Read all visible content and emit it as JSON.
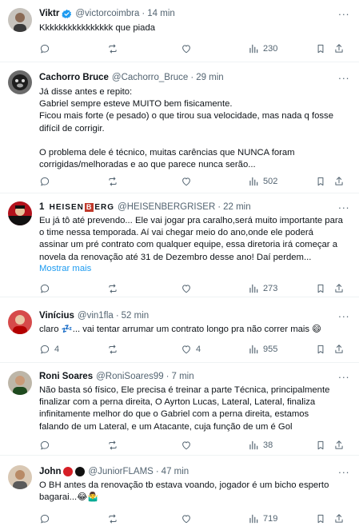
{
  "tweets": [
    {
      "name": "Viktr",
      "verified": true,
      "handle": "@victorcoimbra",
      "time": "14 min",
      "lines": [
        "Kkkkkkkkkkkkkkkk que piada"
      ],
      "replies": "",
      "retweets": "",
      "likes": "",
      "views": "230"
    },
    {
      "name": "Cachorro Bruce",
      "handle": "@Cachorro_Bruce",
      "time": "29 min",
      "lines": [
        "Já disse antes e repito:",
        "Gabriel sempre esteve MUITO bem fisicamente.",
        "Ficou mais forte (e pesado) o que tirou sua velocidade, mas nada q fosse",
        "difícil de corrigir.",
        "",
        "O problema dele é técnico, muitas carências que NUNCA foram",
        "corrigidas/melhoradas e ao que parece nunca serão..."
      ],
      "replies": "",
      "retweets": "",
      "likes": "",
      "views": "502"
    },
    {
      "name_prefix": "1",
      "name_part1": "HEISEN",
      "name_box": "B",
      "name_part2": "ERG",
      "handle": "@HEISENBERGRISER",
      "time": "22 min",
      "lines": [
        "Eu já tô até prevendo... Ele vai jogar pra caralho,será muito importante para",
        "o time nessa temporada. Aí vai chegar meio do ano,onde ele poderá",
        "assinar um pré contrato com qualquer equipe, essa diretoria irá começar a",
        "novela da renovação até 31 de Dezembro desse ano! Daí perdem..."
      ],
      "show_more": "Mostrar mais",
      "replies": "",
      "retweets": "",
      "likes": "",
      "views": "273"
    },
    {
      "name": "Vinícius",
      "handle": "@vin1fla",
      "time": "52 min",
      "lines": [
        "claro 💤... vai tentar arrumar um contrato longo pra não correr mais 😄"
      ],
      "replies": "4",
      "retweets": "",
      "likes": "4",
      "views": "955"
    },
    {
      "name": "Roni Soares",
      "handle": "@RoniSoares99",
      "time": "7 min",
      "lines": [
        "Não basta só físico, Ele precisa é treinar a parte Técnica, principalmente",
        "finalizar com a perna direita, O Ayrton Lucas, Lateral, Lateral, finaliza",
        "infinitamente melhor do que o Gabriel com a perna direita, estamos",
        "falando de um Lateral, e um Atacante, cuja função de um é Gol"
      ],
      "replies": "",
      "retweets": "",
      "likes": "",
      "views": "38"
    },
    {
      "name": "John",
      "handle": "@JuniorFLAMS",
      "time": "47 min",
      "lines": [
        "O BH antes da renovação tb estava voando, jogador é um bicho esperto",
        "bagarai...😂🤷‍♂️"
      ],
      "replies": "",
      "retweets": "",
      "likes": "",
      "views": "719"
    }
  ],
  "colors": {
    "text": "#0f1419",
    "muted": "#536471",
    "link": "#1d9bf0",
    "divider": "#eff3f4",
    "verified": "#1d9bf0"
  },
  "icons": {
    "reply": "reply-icon",
    "retweet": "retweet-icon",
    "like": "heart-icon",
    "views": "views-chart-icon",
    "bookmark": "bookmark-icon",
    "share": "share-icon",
    "more": "more-options-icon"
  }
}
